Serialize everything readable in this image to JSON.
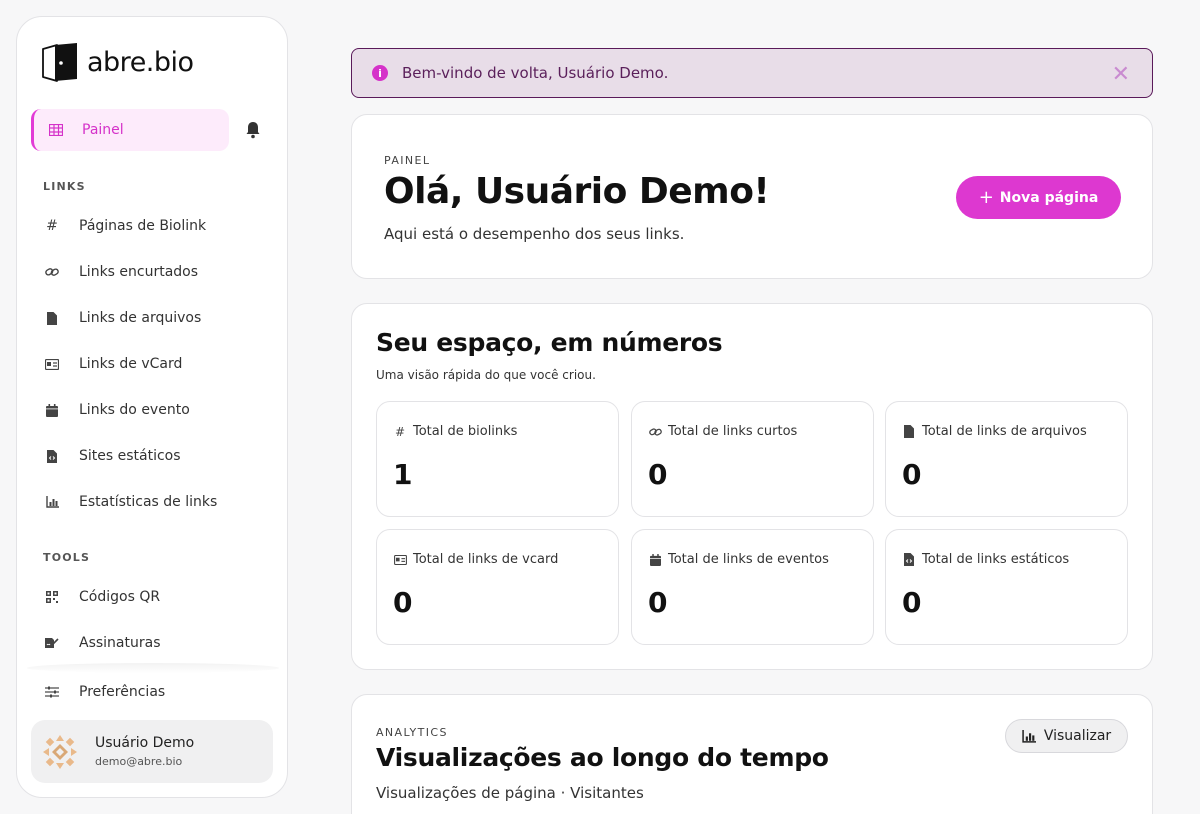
{
  "brand": {
    "name": "abre.bio"
  },
  "sidebar": {
    "active": {
      "label": "Painel",
      "icon": "grid-icon"
    },
    "links_section": "LINKS",
    "links": [
      {
        "label": "Páginas de Biolink",
        "icon": "hash-icon"
      },
      {
        "label": "Links encurtados",
        "icon": "link-icon"
      },
      {
        "label": "Links de arquivos",
        "icon": "file-icon"
      },
      {
        "label": "Links de vCard",
        "icon": "vcard-icon"
      },
      {
        "label": "Links do evento",
        "icon": "calendar-icon"
      },
      {
        "label": "Sites estáticos",
        "icon": "code-file-icon"
      },
      {
        "label": "Estatísticas de links",
        "icon": "chart-icon"
      }
    ],
    "tools_section": "TOOLS",
    "tools": [
      {
        "label": "Códigos QR",
        "icon": "qr-icon"
      },
      {
        "label": "Assinaturas",
        "icon": "signature-icon"
      }
    ],
    "preferences": {
      "label": "Preferências",
      "icon": "sliders-icon"
    },
    "user": {
      "name": "Usuário Demo",
      "email": "demo@abre.bio"
    }
  },
  "alert": {
    "text": "Bem-vindo de volta, Usuário Demo.",
    "close": "✕"
  },
  "hero": {
    "eyebrow": "PAINEL",
    "title": "Olá, Usuário Demo!",
    "subtitle": "Aqui está o desempenho dos seus links.",
    "button": "Nova página",
    "button_icon": "+"
  },
  "stats": {
    "title": "Seu espaço, em números",
    "description": "Uma visão rápida do que você criou.",
    "items": [
      {
        "label": "Total de biolinks",
        "value": "1",
        "icon": "hash-icon"
      },
      {
        "label": "Total de links curtos",
        "value": "0",
        "icon": "link-icon"
      },
      {
        "label": "Total de links de arquivos",
        "value": "0",
        "icon": "file-icon"
      },
      {
        "label": "Total de links de vcard",
        "value": "0",
        "icon": "vcard-icon"
      },
      {
        "label": "Total de links de eventos",
        "value": "0",
        "icon": "calendar-icon"
      },
      {
        "label": "Total de links estáticos",
        "value": "0",
        "icon": "code-file-icon"
      }
    ]
  },
  "analytics": {
    "eyebrow": "ANALYTICS",
    "title": "Visualizações ao longo do tempo",
    "subtitle": "Visualizações de página · Visitantes",
    "button": "Visualizar"
  },
  "colors": {
    "accent": "#dd38d0",
    "alert_bg": "#e8dde8",
    "alert_border": "#5a1a5a"
  }
}
